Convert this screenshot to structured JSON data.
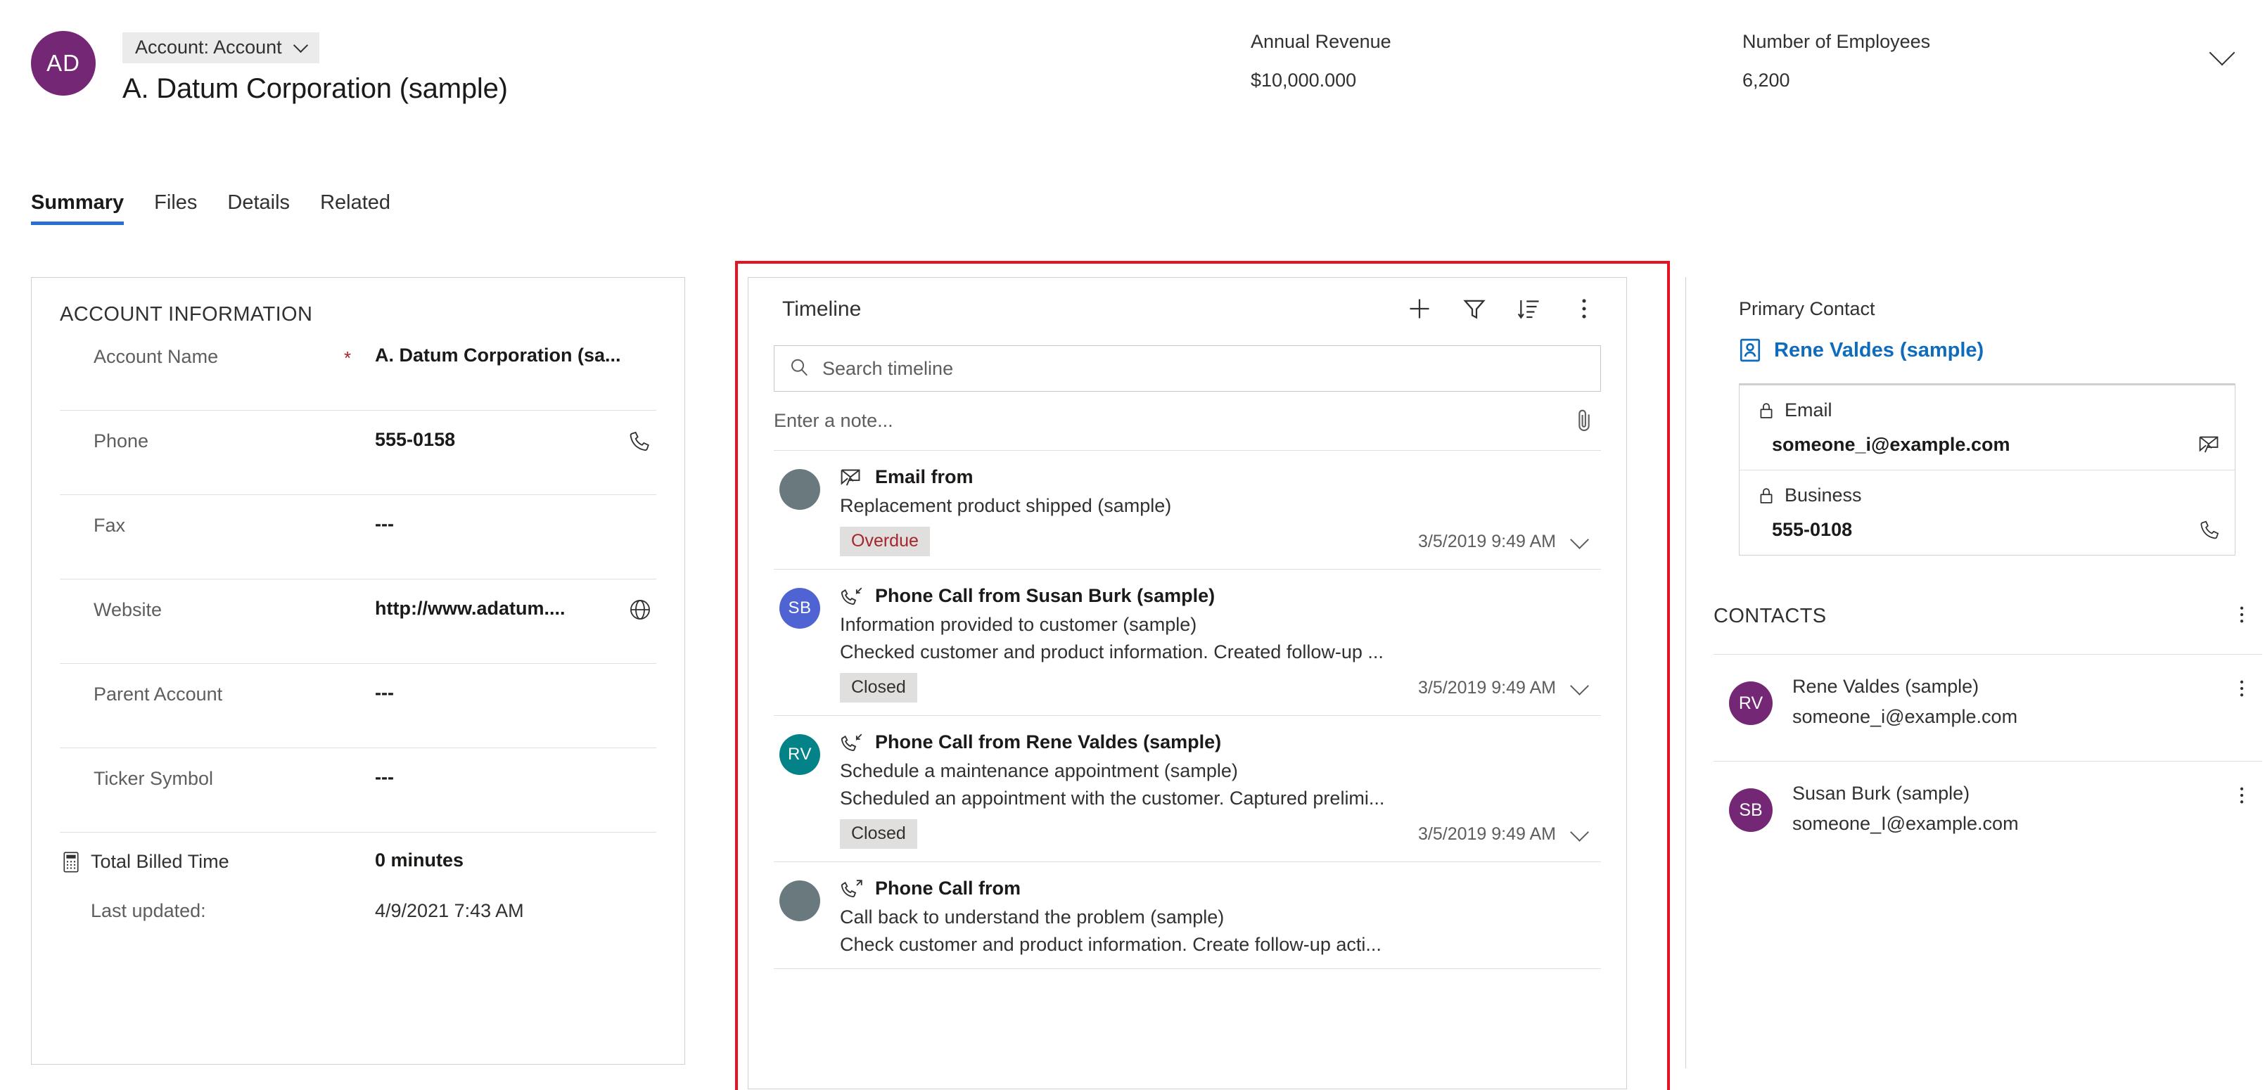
{
  "header": {
    "avatar_initials": "AD",
    "entity_chip": "Account: Account",
    "chip_chevron_icon": "chevron-down-icon",
    "record_title": "A. Datum Corporation (sample)",
    "expand_icon": "chevron-down-icon",
    "stats": [
      {
        "label": "Annual Revenue",
        "value": "$10,000.000"
      },
      {
        "label": "Number of Employees",
        "value": "6,200"
      }
    ]
  },
  "tabs": [
    {
      "label": "Summary",
      "active": true
    },
    {
      "label": "Files",
      "active": false
    },
    {
      "label": "Details",
      "active": false
    },
    {
      "label": "Related",
      "active": false
    }
  ],
  "account_information": {
    "section_title": "ACCOUNT INFORMATION",
    "fields": [
      {
        "label": "Account Name",
        "value": "A. Datum Corporation (sa...",
        "required": "*",
        "icon": ""
      },
      {
        "label": "Phone",
        "value": "555-0158",
        "required": "",
        "icon": "phone-icon"
      },
      {
        "label": "Fax",
        "value": "---",
        "required": "",
        "icon": ""
      },
      {
        "label": "Website",
        "value": "http://www.adatum....",
        "required": "",
        "icon": "globe-icon"
      },
      {
        "label": "Parent Account",
        "value": "---",
        "required": "",
        "icon": ""
      },
      {
        "label": "Ticker Symbol",
        "value": "---",
        "required": "",
        "icon": ""
      }
    ],
    "billed": {
      "icon": "calculator-icon",
      "label": "Total Billed Time",
      "value": "0 minutes"
    },
    "last_updated": {
      "label": "Last updated:",
      "value": "4/9/2021 7:43 AM"
    }
  },
  "timeline": {
    "title": "Timeline",
    "actions": [
      {
        "name": "add-icon",
        "label": "Add"
      },
      {
        "name": "filter-icon",
        "label": "Filter"
      },
      {
        "name": "sort-icon",
        "label": "Sort"
      },
      {
        "name": "more-options-icon",
        "label": "More commands"
      }
    ],
    "search": {
      "placeholder": "Search timeline",
      "value": "",
      "icon": "search-icon"
    },
    "note": {
      "placeholder": "Enter a note...",
      "attach_icon": "paperclip-icon"
    },
    "items": [
      {
        "avatar_initials": "",
        "avatar_color": "#69797e",
        "type_icon": "email-icon",
        "title": "Email from",
        "subject": "Replacement product shipped (sample)",
        "description": "",
        "badge": "Overdue",
        "badge_state": "overdue",
        "date": "3/5/2019 9:49 AM",
        "expand_icon": "chevron-down-icon"
      },
      {
        "avatar_initials": "SB",
        "avatar_color": "#4f63d2",
        "type_icon": "phone-incoming-icon",
        "title": "Phone Call from Susan Burk (sample)",
        "subject": "Information provided to customer (sample)",
        "description": "Checked customer and product information. Created follow-up ...",
        "badge": "Closed",
        "badge_state": "closed",
        "date": "3/5/2019 9:49 AM",
        "expand_icon": "chevron-down-icon"
      },
      {
        "avatar_initials": "RV",
        "avatar_color": "#038387",
        "type_icon": "phone-incoming-icon",
        "title": "Phone Call from Rene Valdes (sample)",
        "subject": "Schedule a maintenance appointment (sample)",
        "description": "Scheduled an appointment with the customer. Captured prelimi...",
        "badge": "Closed",
        "badge_state": "closed",
        "date": "3/5/2019 9:49 AM",
        "expand_icon": "chevron-down-icon"
      },
      {
        "avatar_initials": "",
        "avatar_color": "#69797e",
        "type_icon": "phone-outgoing-icon",
        "title": "Phone Call from",
        "subject": "Call back to understand the problem (sample)",
        "description": "Check customer and product information. Create follow-up acti...",
        "badge": "",
        "badge_state": "",
        "date": "",
        "expand_icon": ""
      }
    ]
  },
  "right_panel": {
    "primary_contact": {
      "label": "Primary Contact",
      "contact_icon": "contact-card-icon",
      "contact_name": "Rene Valdes (sample)",
      "rows": [
        {
          "lock_icon": "lock-icon",
          "label": "Email",
          "value": "someone_i@example.com",
          "action_icon": "email-icon"
        },
        {
          "lock_icon": "lock-icon",
          "label": "Business",
          "value": "555-0108",
          "action_icon": "phone-icon"
        }
      ]
    },
    "contacts": {
      "title": "CONTACTS",
      "more_icon": "more-options-icon",
      "items": [
        {
          "initials": "RV",
          "name": "Rene Valdes (sample)",
          "email": "someone_i@example.com",
          "more_icon": "more-options-icon"
        },
        {
          "initials": "SB",
          "name": "Susan Burk (sample)",
          "email": "someone_I@example.com",
          "more_icon": "more-options-icon"
        }
      ]
    }
  },
  "annotation": {
    "color": "#e81123"
  },
  "colors": {
    "brand_purple": "#742774",
    "accent_blue": "#2b6fd4",
    "link_blue": "#0f6cbd",
    "overdue_red": "#a4262c",
    "annotation_red": "#e81123"
  }
}
